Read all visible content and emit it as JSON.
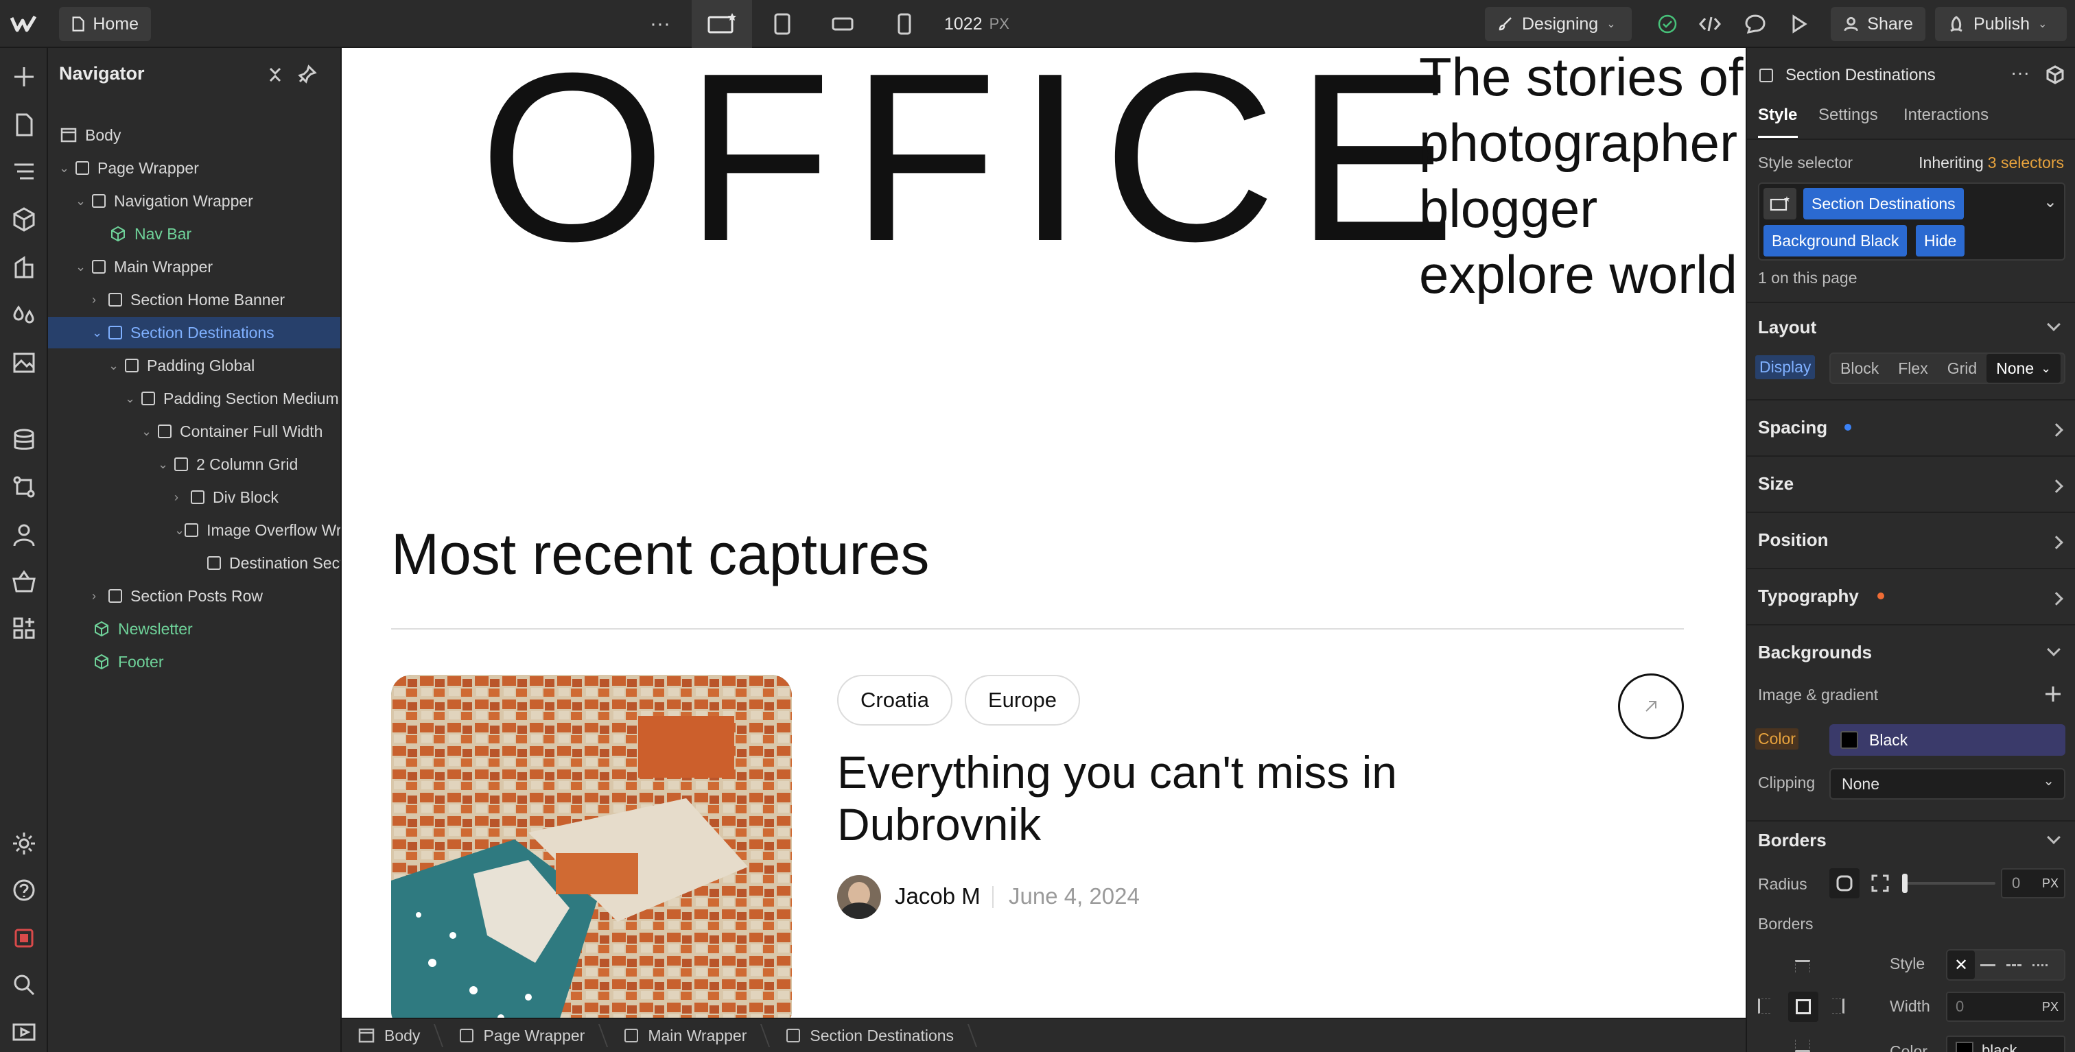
{
  "topbar": {
    "page_label": "Home",
    "width_value": "1022",
    "width_unit": "PX",
    "mode_label": "Designing",
    "share_label": "Share",
    "publish_label": "Publish"
  },
  "navigator": {
    "title": "Navigator",
    "items": [
      {
        "label": "Body"
      },
      {
        "label": "Page Wrapper"
      },
      {
        "label": "Navigation Wrapper"
      },
      {
        "label": "Nav Bar"
      },
      {
        "label": "Main Wrapper"
      },
      {
        "label": "Section Home Banner"
      },
      {
        "label": "Section Destinations"
      },
      {
        "label": "Padding Global"
      },
      {
        "label": "Padding Section Medium"
      },
      {
        "label": "Container Full Width"
      },
      {
        "label": "2 Column Grid"
      },
      {
        "label": "Div Block"
      },
      {
        "label": "Image Overflow Wrapper"
      },
      {
        "label": "Destination Section"
      },
      {
        "label": "Section Posts Row"
      },
      {
        "label": "Newsletter"
      },
      {
        "label": "Footer"
      }
    ]
  },
  "canvas": {
    "hero_word": "OFFICE",
    "hero_text": "The stories of photographer blogger explore world .",
    "section_heading": "Most recent captures",
    "tags": [
      "Croatia",
      "Europe"
    ],
    "post_title": "Everything you can't miss in Dubrovnik",
    "author": "Jacob M",
    "date": "June 4, 2024"
  },
  "breadcrumbs": [
    "Body",
    "Page Wrapper",
    "Main Wrapper",
    "Section Destinations"
  ],
  "panel": {
    "element_name": "Section Destinations",
    "tabs": [
      "Style",
      "Settings",
      "Interactions"
    ],
    "style_selector_label": "Style selector",
    "inheriting_label": "Inheriting",
    "inheriting_count": "3 selectors",
    "selectors": [
      "Section Destinations",
      "Background Black",
      "Hide"
    ],
    "on_page": "1 on this page",
    "layout": {
      "title": "Layout",
      "display_label": "Display",
      "options": [
        "Block",
        "Flex",
        "Grid"
      ],
      "selected": "None"
    },
    "sections": [
      "Spacing",
      "Size",
      "Position",
      "Typography"
    ],
    "backgrounds": {
      "title": "Backgrounds",
      "image_gradient": "Image & gradient",
      "color_label": "Color",
      "color_value": "Black",
      "clipping_label": "Clipping",
      "clipping_value": "None"
    },
    "borders": {
      "title": "Borders",
      "radius_label": "Radius",
      "radius_value": "0",
      "radius_unit": "PX",
      "borders_label": "Borders",
      "style_label": "Style",
      "width_label": "Width",
      "width_placeholder": "0",
      "width_unit": "PX",
      "color_label": "Color",
      "color_value": "black"
    },
    "colors": {
      "accent": "#2b6ad1",
      "spacing_dot": "#3b82f6",
      "typography_dot": "#ef6c35",
      "inheriting": "#e8a33d"
    }
  }
}
